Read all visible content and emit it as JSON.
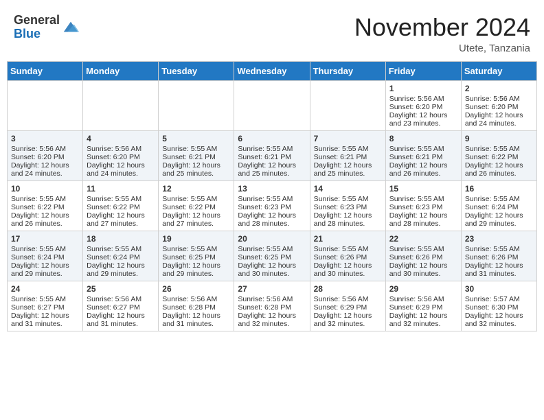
{
  "header": {
    "logo_general": "General",
    "logo_blue": "Blue",
    "month_year": "November 2024",
    "location": "Utete, Tanzania"
  },
  "days_of_week": [
    "Sunday",
    "Monday",
    "Tuesday",
    "Wednesday",
    "Thursday",
    "Friday",
    "Saturday"
  ],
  "weeks": [
    [
      {
        "day": "",
        "sunrise": "",
        "sunset": "",
        "daylight": "",
        "empty": true
      },
      {
        "day": "",
        "sunrise": "",
        "sunset": "",
        "daylight": "",
        "empty": true
      },
      {
        "day": "",
        "sunrise": "",
        "sunset": "",
        "daylight": "",
        "empty": true
      },
      {
        "day": "",
        "sunrise": "",
        "sunset": "",
        "daylight": "",
        "empty": true
      },
      {
        "day": "",
        "sunrise": "",
        "sunset": "",
        "daylight": "",
        "empty": true
      },
      {
        "day": "1",
        "sunrise": "Sunrise: 5:56 AM",
        "sunset": "Sunset: 6:20 PM",
        "daylight": "Daylight: 12 hours and 23 minutes."
      },
      {
        "day": "2",
        "sunrise": "Sunrise: 5:56 AM",
        "sunset": "Sunset: 6:20 PM",
        "daylight": "Daylight: 12 hours and 24 minutes."
      }
    ],
    [
      {
        "day": "3",
        "sunrise": "Sunrise: 5:56 AM",
        "sunset": "Sunset: 6:20 PM",
        "daylight": "Daylight: 12 hours and 24 minutes."
      },
      {
        "day": "4",
        "sunrise": "Sunrise: 5:56 AM",
        "sunset": "Sunset: 6:20 PM",
        "daylight": "Daylight: 12 hours and 24 minutes."
      },
      {
        "day": "5",
        "sunrise": "Sunrise: 5:55 AM",
        "sunset": "Sunset: 6:21 PM",
        "daylight": "Daylight: 12 hours and 25 minutes."
      },
      {
        "day": "6",
        "sunrise": "Sunrise: 5:55 AM",
        "sunset": "Sunset: 6:21 PM",
        "daylight": "Daylight: 12 hours and 25 minutes."
      },
      {
        "day": "7",
        "sunrise": "Sunrise: 5:55 AM",
        "sunset": "Sunset: 6:21 PM",
        "daylight": "Daylight: 12 hours and 25 minutes."
      },
      {
        "day": "8",
        "sunrise": "Sunrise: 5:55 AM",
        "sunset": "Sunset: 6:21 PM",
        "daylight": "Daylight: 12 hours and 26 minutes."
      },
      {
        "day": "9",
        "sunrise": "Sunrise: 5:55 AM",
        "sunset": "Sunset: 6:22 PM",
        "daylight": "Daylight: 12 hours and 26 minutes."
      }
    ],
    [
      {
        "day": "10",
        "sunrise": "Sunrise: 5:55 AM",
        "sunset": "Sunset: 6:22 PM",
        "daylight": "Daylight: 12 hours and 26 minutes."
      },
      {
        "day": "11",
        "sunrise": "Sunrise: 5:55 AM",
        "sunset": "Sunset: 6:22 PM",
        "daylight": "Daylight: 12 hours and 27 minutes."
      },
      {
        "day": "12",
        "sunrise": "Sunrise: 5:55 AM",
        "sunset": "Sunset: 6:22 PM",
        "daylight": "Daylight: 12 hours and 27 minutes."
      },
      {
        "day": "13",
        "sunrise": "Sunrise: 5:55 AM",
        "sunset": "Sunset: 6:23 PM",
        "daylight": "Daylight: 12 hours and 28 minutes."
      },
      {
        "day": "14",
        "sunrise": "Sunrise: 5:55 AM",
        "sunset": "Sunset: 6:23 PM",
        "daylight": "Daylight: 12 hours and 28 minutes."
      },
      {
        "day": "15",
        "sunrise": "Sunrise: 5:55 AM",
        "sunset": "Sunset: 6:23 PM",
        "daylight": "Daylight: 12 hours and 28 minutes."
      },
      {
        "day": "16",
        "sunrise": "Sunrise: 5:55 AM",
        "sunset": "Sunset: 6:24 PM",
        "daylight": "Daylight: 12 hours and 29 minutes."
      }
    ],
    [
      {
        "day": "17",
        "sunrise": "Sunrise: 5:55 AM",
        "sunset": "Sunset: 6:24 PM",
        "daylight": "Daylight: 12 hours and 29 minutes."
      },
      {
        "day": "18",
        "sunrise": "Sunrise: 5:55 AM",
        "sunset": "Sunset: 6:24 PM",
        "daylight": "Daylight: 12 hours and 29 minutes."
      },
      {
        "day": "19",
        "sunrise": "Sunrise: 5:55 AM",
        "sunset": "Sunset: 6:25 PM",
        "daylight": "Daylight: 12 hours and 29 minutes."
      },
      {
        "day": "20",
        "sunrise": "Sunrise: 5:55 AM",
        "sunset": "Sunset: 6:25 PM",
        "daylight": "Daylight: 12 hours and 30 minutes."
      },
      {
        "day": "21",
        "sunrise": "Sunrise: 5:55 AM",
        "sunset": "Sunset: 6:26 PM",
        "daylight": "Daylight: 12 hours and 30 minutes."
      },
      {
        "day": "22",
        "sunrise": "Sunrise: 5:55 AM",
        "sunset": "Sunset: 6:26 PM",
        "daylight": "Daylight: 12 hours and 30 minutes."
      },
      {
        "day": "23",
        "sunrise": "Sunrise: 5:55 AM",
        "sunset": "Sunset: 6:26 PM",
        "daylight": "Daylight: 12 hours and 31 minutes."
      }
    ],
    [
      {
        "day": "24",
        "sunrise": "Sunrise: 5:55 AM",
        "sunset": "Sunset: 6:27 PM",
        "daylight": "Daylight: 12 hours and 31 minutes."
      },
      {
        "day": "25",
        "sunrise": "Sunrise: 5:56 AM",
        "sunset": "Sunset: 6:27 PM",
        "daylight": "Daylight: 12 hours and 31 minutes."
      },
      {
        "day": "26",
        "sunrise": "Sunrise: 5:56 AM",
        "sunset": "Sunset: 6:28 PM",
        "daylight": "Daylight: 12 hours and 31 minutes."
      },
      {
        "day": "27",
        "sunrise": "Sunrise: 5:56 AM",
        "sunset": "Sunset: 6:28 PM",
        "daylight": "Daylight: 12 hours and 32 minutes."
      },
      {
        "day": "28",
        "sunrise": "Sunrise: 5:56 AM",
        "sunset": "Sunset: 6:29 PM",
        "daylight": "Daylight: 12 hours and 32 minutes."
      },
      {
        "day": "29",
        "sunrise": "Sunrise: 5:56 AM",
        "sunset": "Sunset: 6:29 PM",
        "daylight": "Daylight: 12 hours and 32 minutes."
      },
      {
        "day": "30",
        "sunrise": "Sunrise: 5:57 AM",
        "sunset": "Sunset: 6:30 PM",
        "daylight": "Daylight: 12 hours and 32 minutes."
      }
    ]
  ]
}
